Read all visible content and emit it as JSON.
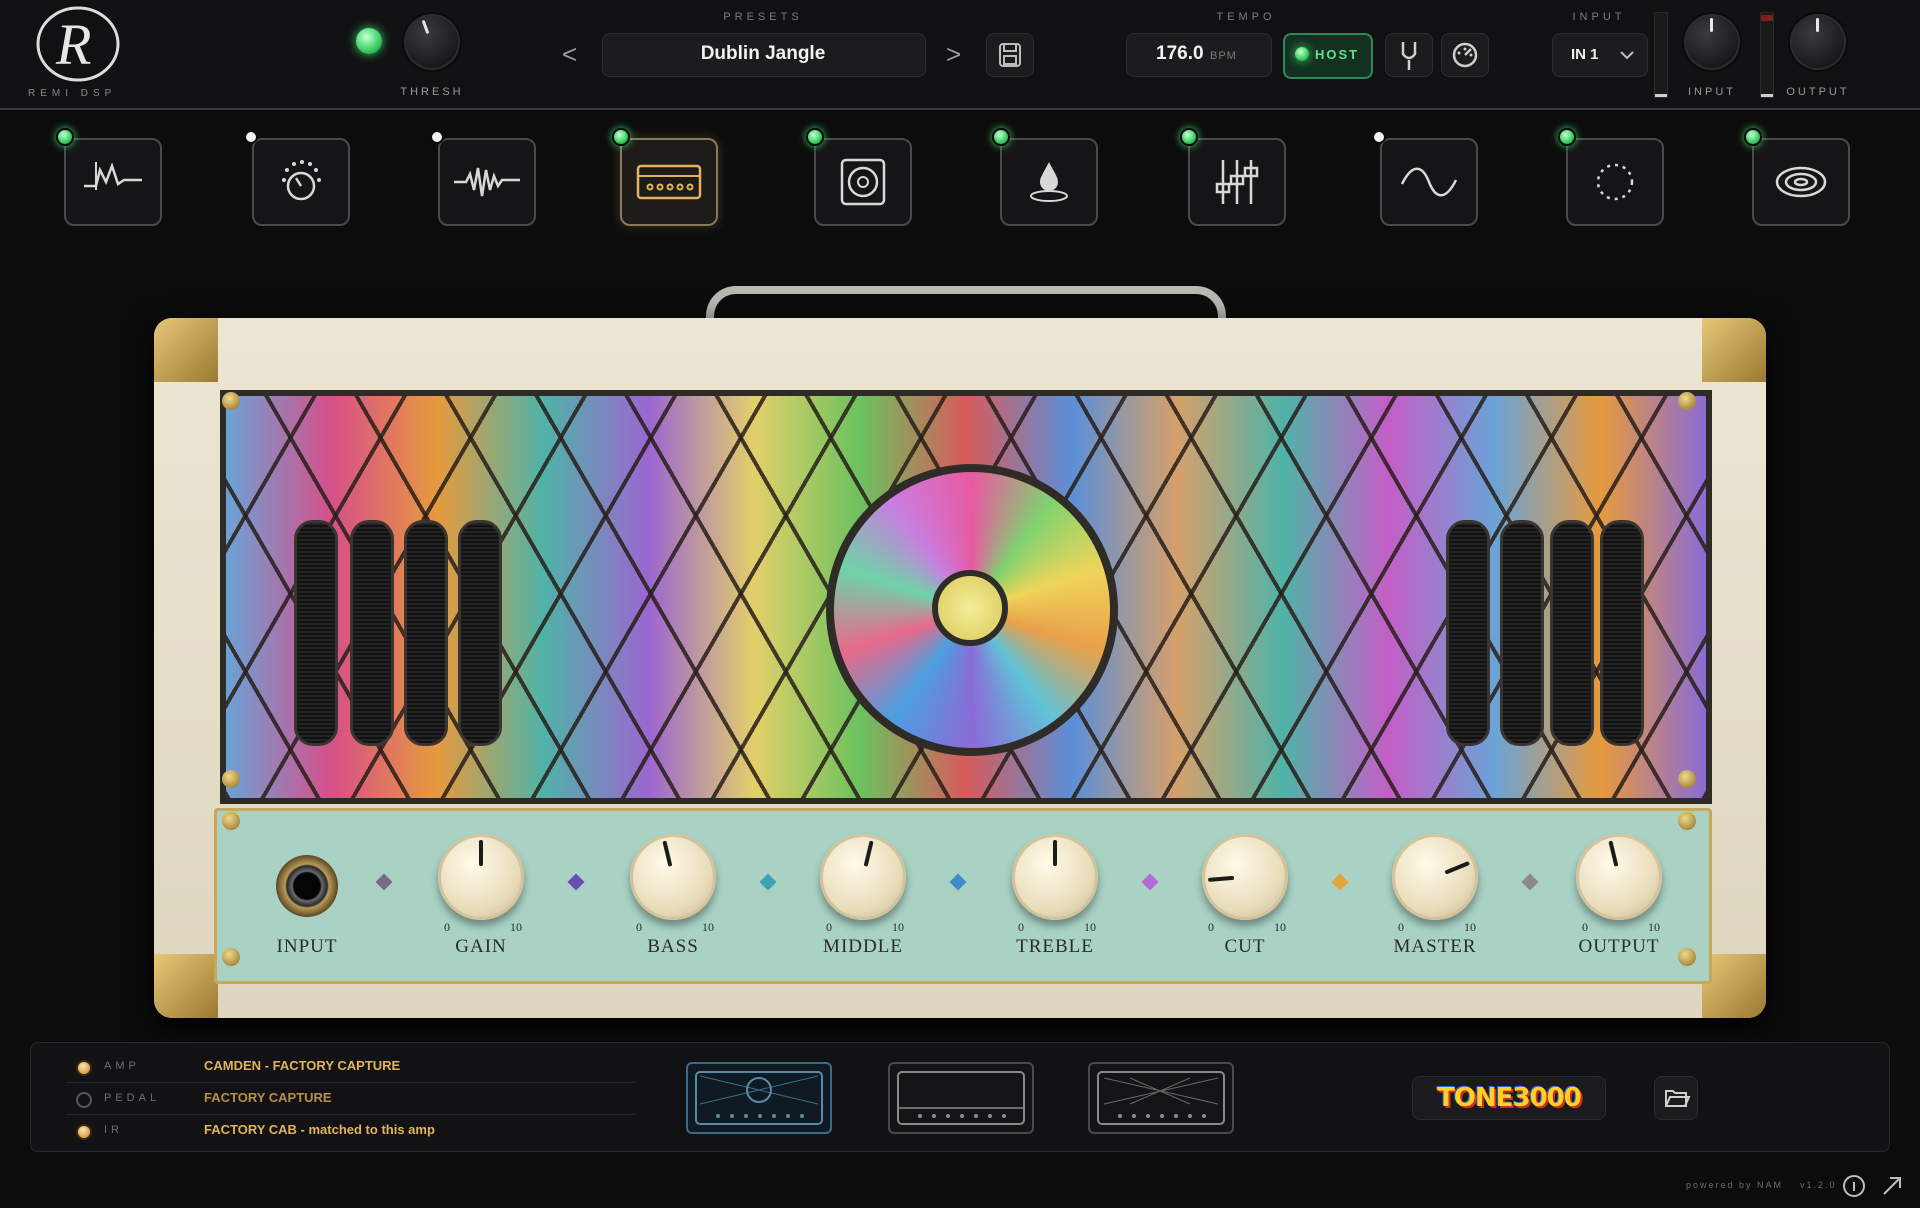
{
  "brand": {
    "logo_letter": "R",
    "name": "REMI DSP"
  },
  "header": {
    "thresh_label": "THRESH",
    "presets_label": "PRESETS",
    "preset_name": "Dublin Jangle",
    "prev_symbol": "<",
    "next_symbol": ">",
    "tempo_label": "TEMPO",
    "tempo_value": "176.0",
    "tempo_unit": "BPM",
    "host_label": "HOST",
    "input_section_label": "INPUT",
    "input_select_value": "IN 1",
    "input_knob_label": "INPUT",
    "output_knob_label": "OUTPUT"
  },
  "fx_chain": [
    {
      "icon": "noise-gate-icon",
      "enabled": true
    },
    {
      "icon": "drive-knob-icon",
      "enabled": false
    },
    {
      "icon": "waveform-icon",
      "enabled": false
    },
    {
      "icon": "amp-icon",
      "enabled": true,
      "selected": true
    },
    {
      "icon": "speaker-cab-icon",
      "enabled": true
    },
    {
      "icon": "drop-reverb-icon",
      "enabled": true
    },
    {
      "icon": "eq-sliders-icon",
      "enabled": true
    },
    {
      "icon": "sine-modulation-icon",
      "enabled": false
    },
    {
      "icon": "dotted-circle-delay-icon",
      "enabled": true
    },
    {
      "icon": "ripple-icon",
      "enabled": true
    }
  ],
  "amp": {
    "input_label": "INPUT",
    "scale_min": "0",
    "scale_max": "10",
    "knobs": [
      {
        "label": "GAIN",
        "value": 5.0
      },
      {
        "label": "BASS",
        "value": 4.5
      },
      {
        "label": "MIDDLE",
        "value": 5.5
      },
      {
        "label": "TREBLE",
        "value": 5.0
      },
      {
        "label": "CUT",
        "value": 1.5
      },
      {
        "label": "MASTER",
        "value": 7.5
      },
      {
        "label": "OUTPUT",
        "value": 4.5
      }
    ]
  },
  "loader": {
    "rows": [
      {
        "key": "AMP",
        "value": "CAMDEN - FACTORY CAPTURE",
        "active": true
      },
      {
        "key": "PEDAL",
        "value": "FACTORY CAPTURE",
        "active": false
      },
      {
        "key": "IR",
        "value": "FACTORY CAB - matched to this amp",
        "active": true
      }
    ],
    "tone_brand": "TONE3000"
  },
  "footer": {
    "powered": "powered by NAM",
    "version": "v1.2.0"
  },
  "colors": {
    "accent_green": "#3fd46a",
    "accent_gold": "#e3b35c",
    "panel_teal": "#a9d2c4"
  }
}
